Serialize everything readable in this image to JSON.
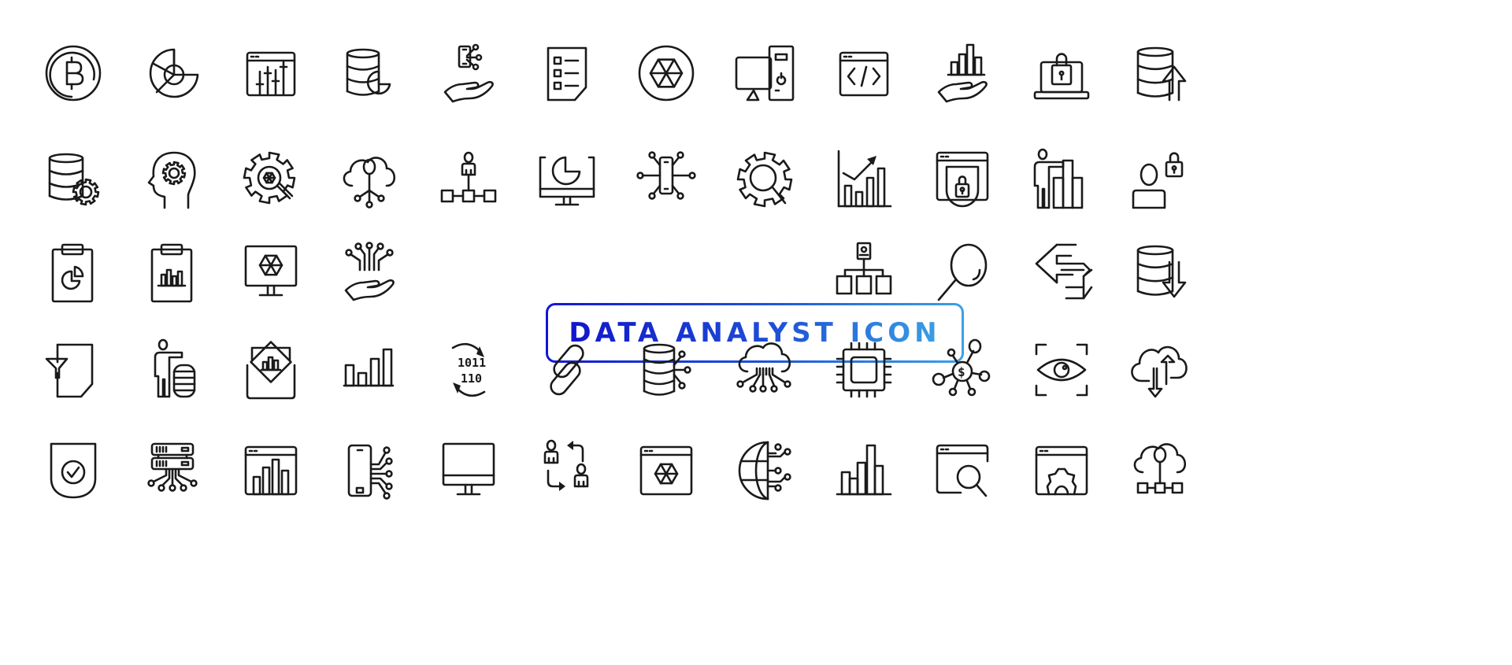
{
  "title": {
    "text": "DATA ANALYST ICON",
    "gradient_start": "#1316d4",
    "gradient_end": "#3aa2e6"
  },
  "icon_color": "#1a1a1a",
  "background": "#ffffff",
  "icons": [
    {
      "row": 1,
      "col": 1,
      "name": "bitcoin-coin-icon"
    },
    {
      "row": 1,
      "col": 2,
      "name": "radial-chart-icon"
    },
    {
      "row": 1,
      "col": 3,
      "name": "browser-sliders-icon"
    },
    {
      "row": 1,
      "col": 4,
      "name": "database-pie-chart-icon"
    },
    {
      "row": 1,
      "col": 5,
      "name": "hand-smartphone-network-icon"
    },
    {
      "row": 1,
      "col": 6,
      "name": "checklist-document-icon"
    },
    {
      "row": 1,
      "col": 7,
      "name": "hexagon-cube-circle-icon"
    },
    {
      "row": 1,
      "col": 8,
      "name": "desktop-computer-tower-icon"
    },
    {
      "row": 1,
      "col": 9,
      "name": "browser-code-icon"
    },
    {
      "row": 1,
      "col": 10,
      "name": "hand-bar-chart-icon"
    },
    {
      "row": 1,
      "col": 11,
      "name": "laptop-lock-icon"
    },
    {
      "row": 1,
      "col": 12,
      "name": "database-upload-icon"
    },
    {
      "row": 2,
      "col": 1,
      "name": "database-gear-icon"
    },
    {
      "row": 2,
      "col": 2,
      "name": "head-gear-icon"
    },
    {
      "row": 2,
      "col": 3,
      "name": "gear-magnifier-icon"
    },
    {
      "row": 2,
      "col": 4,
      "name": "cloud-network-icon"
    },
    {
      "row": 2,
      "col": 5,
      "name": "user-hierarchy-icon"
    },
    {
      "row": 2,
      "col": 6,
      "name": "monitor-pie-chart-icon"
    },
    {
      "row": 2,
      "col": 7,
      "name": "smartphone-circuit-icon"
    },
    {
      "row": 2,
      "col": 8,
      "name": "gear-search-icon"
    },
    {
      "row": 2,
      "col": 9,
      "name": "growth-chart-arrow-icon"
    },
    {
      "row": 2,
      "col": 10,
      "name": "browser-shield-lock-icon"
    },
    {
      "row": 2,
      "col": 11,
      "name": "person-presenting-chart-icon"
    },
    {
      "row": 2,
      "col": 12,
      "name": "user-lock-icon"
    },
    {
      "row": 3,
      "col": 1,
      "name": "clipboard-pie-chart-icon"
    },
    {
      "row": 3,
      "col": 2,
      "name": "clipboard-bar-chart-icon"
    },
    {
      "row": 3,
      "col": 3,
      "name": "monitor-hexagon-icon"
    },
    {
      "row": 3,
      "col": 4,
      "name": "hand-circuit-icon"
    },
    {
      "row": 3,
      "col": 9,
      "name": "org-chart-icon"
    },
    {
      "row": 3,
      "col": 10,
      "name": "magnifier-icon"
    },
    {
      "row": 3,
      "col": 11,
      "name": "data-transfer-arrows-icon"
    },
    {
      "row": 3,
      "col": 12,
      "name": "database-download-icon"
    },
    {
      "row": 4,
      "col": 1,
      "name": "document-filter-icon"
    },
    {
      "row": 4,
      "col": 2,
      "name": "person-coins-icon"
    },
    {
      "row": 4,
      "col": 3,
      "name": "envelope-report-icon"
    },
    {
      "row": 4,
      "col": 4,
      "name": "bar-chart-icon"
    },
    {
      "row": 4,
      "col": 5,
      "name": "binary-sync-icon"
    },
    {
      "row": 4,
      "col": 6,
      "name": "chain-link-icon"
    },
    {
      "row": 4,
      "col": 7,
      "name": "database-network-icon"
    },
    {
      "row": 4,
      "col": 8,
      "name": "cloud-circuit-icon"
    },
    {
      "row": 4,
      "col": 9,
      "name": "cpu-chip-icon"
    },
    {
      "row": 4,
      "col": 10,
      "name": "dollar-network-icon"
    },
    {
      "row": 4,
      "col": 11,
      "name": "eye-scan-icon"
    },
    {
      "row": 4,
      "col": 12,
      "name": "cloud-sync-arrows-icon"
    },
    {
      "row": 5,
      "col": 1,
      "name": "shield-check-icon"
    },
    {
      "row": 5,
      "col": 2,
      "name": "server-network-icon"
    },
    {
      "row": 5,
      "col": 3,
      "name": "browser-bar-chart-icon"
    },
    {
      "row": 5,
      "col": 4,
      "name": "smartphone-network-icon"
    },
    {
      "row": 5,
      "col": 5,
      "name": "monitor-icon"
    },
    {
      "row": 5,
      "col": 6,
      "name": "user-exchange-icon"
    },
    {
      "row": 5,
      "col": 7,
      "name": "browser-hexagon-icon"
    },
    {
      "row": 5,
      "col": 8,
      "name": "globe-network-icon"
    },
    {
      "row": 5,
      "col": 9,
      "name": "column-chart-icon"
    },
    {
      "row": 5,
      "col": 10,
      "name": "browser-search-icon"
    },
    {
      "row": 5,
      "col": 11,
      "name": "browser-settings-icon"
    },
    {
      "row": 5,
      "col": 12,
      "name": "cloud-hierarchy-icon"
    }
  ]
}
